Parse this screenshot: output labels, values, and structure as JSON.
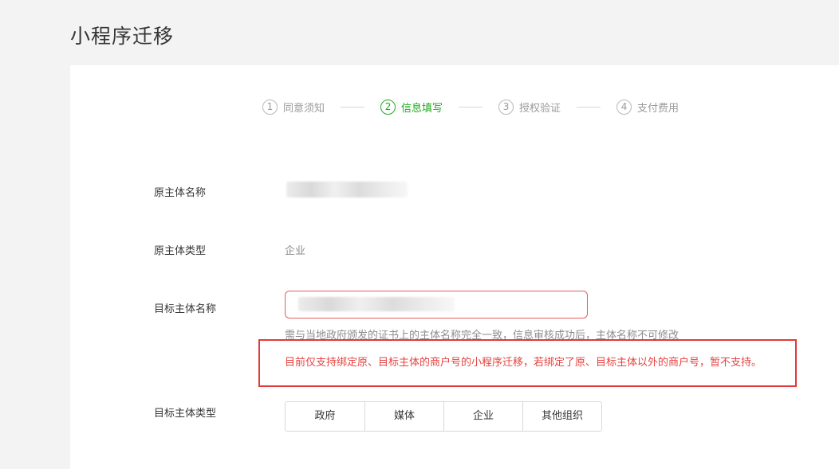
{
  "page": {
    "title": "小程序迁移"
  },
  "steps": [
    {
      "num": "1",
      "label": "同意须知",
      "active": false
    },
    {
      "num": "2",
      "label": "信息填写",
      "active": true
    },
    {
      "num": "3",
      "label": "授权验证",
      "active": false
    },
    {
      "num": "4",
      "label": "支付费用",
      "active": false
    }
  ],
  "form": {
    "original_name_label": "原主体名称",
    "original_type_label": "原主体类型",
    "original_type_value": "企业",
    "target_name_label": "目标主体名称",
    "target_name_hint": "需与当地政府颁发的证书上的主体名称完全一致，信息审核成功后，主体名称不可修改",
    "warning": "目前仅支持绑定原、目标主体的商户号的小程序迁移，若绑定了原、目标主体以外的商户号，暂不支持。",
    "target_type_label": "目标主体类型",
    "target_type_options": [
      "政府",
      "媒体",
      "企业",
      "其他组织"
    ]
  },
  "colors": {
    "accent": "#1aad19",
    "warning": "#e64340",
    "highlight_border": "#e03a3a"
  }
}
